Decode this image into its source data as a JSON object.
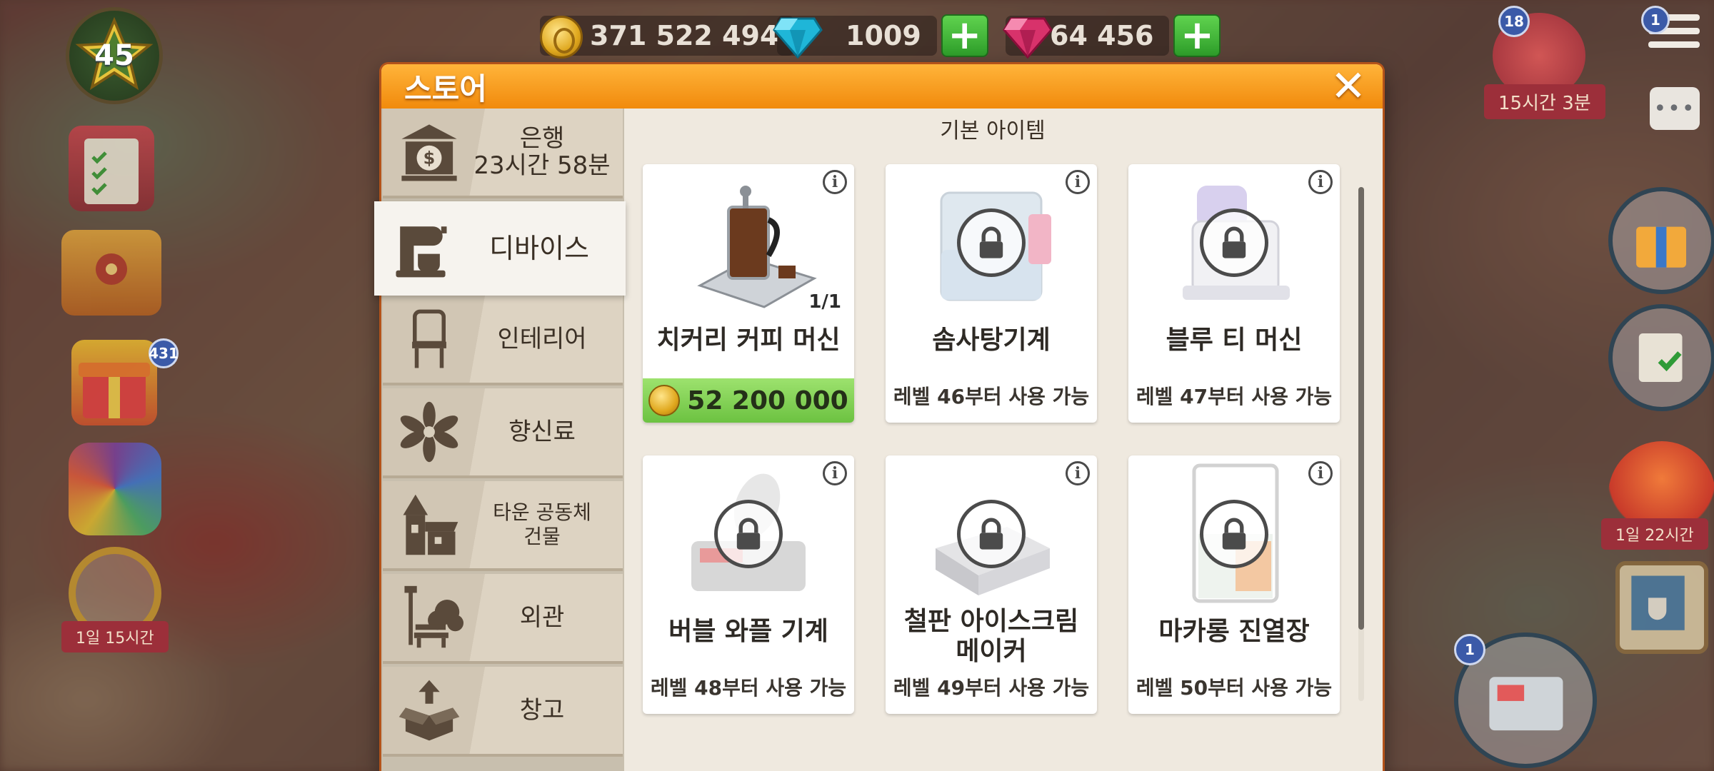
{
  "hud": {
    "coins": "371 522 494",
    "diamonds": "1009",
    "rubies": "64 456",
    "level": "45",
    "gift_badge": "431",
    "left_timer": "1일 15시간",
    "top_right_gift_count": "18",
    "top_right_gift_timer": "15시간 3분",
    "menu_badge": "1",
    "balloon_timer": "1일 22시간",
    "register_badge": "1"
  },
  "store": {
    "title": "스토어",
    "close_label": "✕",
    "section_title": "기본 아이템",
    "sidebar": [
      {
        "label": "은행\n23시간 58분",
        "icon": "bank-icon"
      },
      {
        "label": "디바이스",
        "icon": "mixer-icon",
        "active": true
      },
      {
        "label": "인테리어",
        "icon": "chair-icon"
      },
      {
        "label": "향신료",
        "icon": "star-anise-icon"
      },
      {
        "label": "타운 공동체\n건물",
        "icon": "building-icon"
      },
      {
        "label": "외관",
        "icon": "bench-icon"
      },
      {
        "label": "창고",
        "icon": "box-icon"
      }
    ],
    "items": [
      {
        "name": "치커리 커피 머신",
        "qty": "1/1",
        "price": "52 200 000",
        "locked": false
      },
      {
        "name": "솜사탕기계",
        "req": "레벨 46부터 사용 가능",
        "locked": true
      },
      {
        "name": "블루 티 머신",
        "req": "레벨 47부터 사용 가능",
        "locked": true
      },
      {
        "name": "버블 와플 기계",
        "req": "레벨 48부터 사용 가능",
        "locked": true
      },
      {
        "name": "철판 아이스크림\n메이커",
        "req": "레벨 49부터 사용 가능",
        "locked": true
      },
      {
        "name": "마카롱 진열장",
        "req": "레벨 50부터 사용 가능",
        "locked": true
      }
    ]
  },
  "colors": {
    "header_orange": "#f18a0c",
    "price_green": "#6cc241",
    "panel_bg": "#efe9df"
  }
}
